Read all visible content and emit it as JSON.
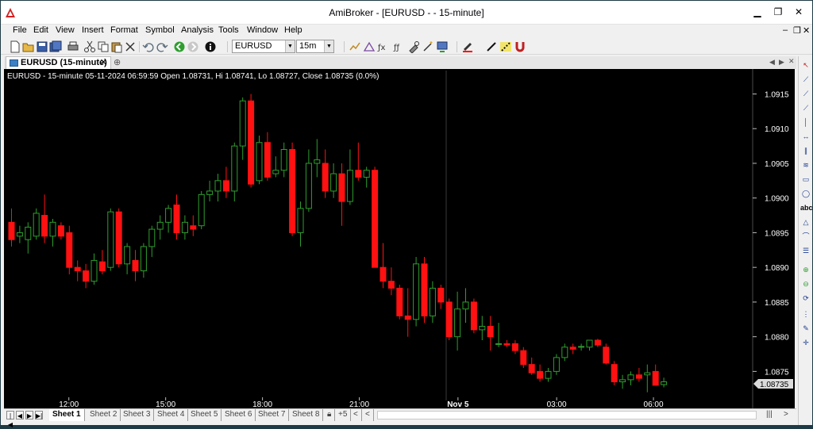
{
  "window": {
    "title": "AmiBroker - [EURUSD -  - 15-minute]",
    "min_label": "▁",
    "max_label": "❐",
    "close_label": "✕"
  },
  "menu": {
    "items": [
      "File",
      "Edit",
      "View",
      "Insert",
      "Format",
      "Symbol",
      "Analysis",
      "Tools",
      "Window",
      "Help"
    ]
  },
  "toolbar": {
    "symbol": "EURUSD",
    "interval": "15m"
  },
  "tab": {
    "label": "EURUSD (15-minute)",
    "close": "✕"
  },
  "chart": {
    "info_line": "EURUSD - 15-minute 05-11-2024 06:59:59 Open 1.08731, Hi 1.08741, Lo 1.08727, Close 1.08735 (0.0%)",
    "last_price": "1.08735",
    "y_ticks": [
      "1.0915",
      "1.0910",
      "1.0905",
      "1.0900",
      "1.0895",
      "1.0890",
      "1.0885",
      "1.0880",
      "1.0875"
    ],
    "x_ticks": [
      "12:00",
      "15:00",
      "18:00",
      "21:00",
      "Nov 5",
      "03:00",
      "06:00"
    ],
    "colors": {
      "up": "#2e9e2e",
      "down": "#ff1111",
      "background": "#000000",
      "axis_text": "#ffffff"
    }
  },
  "chart_data": {
    "type": "candlestick",
    "symbol": "EURUSD",
    "interval": "15-minute",
    "ylim": [
      1.08715,
      1.0917
    ],
    "candles": [
      {
        "o": 1.08965,
        "h": 1.08985,
        "l": 1.0893,
        "c": 1.0894
      },
      {
        "o": 1.08945,
        "h": 1.0896,
        "l": 1.08935,
        "c": 1.0895
      },
      {
        "o": 1.0894,
        "h": 1.08965,
        "l": 1.0892,
        "c": 1.08958
      },
      {
        "o": 1.08945,
        "h": 1.08985,
        "l": 1.0894,
        "c": 1.08978
      },
      {
        "o": 1.08975,
        "h": 1.09005,
        "l": 1.08935,
        "c": 1.08945
      },
      {
        "o": 1.08945,
        "h": 1.0897,
        "l": 1.0893,
        "c": 1.08965
      },
      {
        "o": 1.0896,
        "h": 1.08965,
        "l": 1.0894,
        "c": 1.08945
      },
      {
        "o": 1.0895,
        "h": 1.0896,
        "l": 1.0889,
        "c": 1.089
      },
      {
        "o": 1.089,
        "h": 1.0891,
        "l": 1.0888,
        "c": 1.08895
      },
      {
        "o": 1.08895,
        "h": 1.08905,
        "l": 1.0887,
        "c": 1.0888
      },
      {
        "o": 1.0888,
        "h": 1.0892,
        "l": 1.08875,
        "c": 1.0891
      },
      {
        "o": 1.08908,
        "h": 1.08925,
        "l": 1.0889,
        "c": 1.08895
      },
      {
        "o": 1.089,
        "h": 1.08985,
        "l": 1.08895,
        "c": 1.0898
      },
      {
        "o": 1.0898,
        "h": 1.08985,
        "l": 1.089,
        "c": 1.08905
      },
      {
        "o": 1.08905,
        "h": 1.08935,
        "l": 1.0889,
        "c": 1.0893
      },
      {
        "o": 1.0891,
        "h": 1.08925,
        "l": 1.0888,
        "c": 1.08895
      },
      {
        "o": 1.08895,
        "h": 1.08935,
        "l": 1.08885,
        "c": 1.0893
      },
      {
        "o": 1.0893,
        "h": 1.0896,
        "l": 1.08915,
        "c": 1.08955
      },
      {
        "o": 1.08955,
        "h": 1.08975,
        "l": 1.0894,
        "c": 1.08965
      },
      {
        "o": 1.08965,
        "h": 1.0899,
        "l": 1.0895,
        "c": 1.08985
      },
      {
        "o": 1.0899,
        "h": 1.09005,
        "l": 1.0894,
        "c": 1.0895
      },
      {
        "o": 1.0895,
        "h": 1.08975,
        "l": 1.0894,
        "c": 1.08965
      },
      {
        "o": 1.0896,
        "h": 1.08975,
        "l": 1.08945,
        "c": 1.08955
      },
      {
        "o": 1.0896,
        "h": 1.0901,
        "l": 1.08955,
        "c": 1.09005
      },
      {
        "o": 1.09005,
        "h": 1.09025,
        "l": 1.08995,
        "c": 1.0901
      },
      {
        "o": 1.0901,
        "h": 1.09035,
        "l": 1.08995,
        "c": 1.09025
      },
      {
        "o": 1.09025,
        "h": 1.09045,
        "l": 1.09,
        "c": 1.0901
      },
      {
        "o": 1.0901,
        "h": 1.0908,
        "l": 1.08995,
        "c": 1.09075
      },
      {
        "o": 1.09075,
        "h": 1.09145,
        "l": 1.09055,
        "c": 1.0914
      },
      {
        "o": 1.0914,
        "h": 1.0915,
        "l": 1.09015,
        "c": 1.0902
      },
      {
        "o": 1.09025,
        "h": 1.0909,
        "l": 1.0902,
        "c": 1.0908
      },
      {
        "o": 1.0908,
        "h": 1.09095,
        "l": 1.09025,
        "c": 1.0903
      },
      {
        "o": 1.09035,
        "h": 1.0906,
        "l": 1.0903,
        "c": 1.0904
      },
      {
        "o": 1.0904,
        "h": 1.0908,
        "l": 1.0903,
        "c": 1.0907
      },
      {
        "o": 1.0907,
        "h": 1.0908,
        "l": 1.08945,
        "c": 1.0895
      },
      {
        "o": 1.0895,
        "h": 1.08995,
        "l": 1.0893,
        "c": 1.08985
      },
      {
        "o": 1.08985,
        "h": 1.0907,
        "l": 1.0898,
        "c": 1.0905
      },
      {
        "o": 1.0905,
        "h": 1.09085,
        "l": 1.0903,
        "c": 1.09055
      },
      {
        "o": 1.0905,
        "h": 1.0907,
        "l": 1.09,
        "c": 1.0901
      },
      {
        "o": 1.0901,
        "h": 1.0905,
        "l": 1.09,
        "c": 1.09035
      },
      {
        "o": 1.09035,
        "h": 1.0905,
        "l": 1.0896,
        "c": 1.08995
      },
      {
        "o": 1.08995,
        "h": 1.0907,
        "l": 1.0899,
        "c": 1.0904
      },
      {
        "o": 1.0904,
        "h": 1.0908,
        "l": 1.09025,
        "c": 1.0903
      },
      {
        "o": 1.0903,
        "h": 1.09045,
        "l": 1.09015,
        "c": 1.0904
      },
      {
        "o": 1.0904,
        "h": 1.09045,
        "l": 1.089,
        "c": 1.089
      },
      {
        "o": 1.089,
        "h": 1.08935,
        "l": 1.0887,
        "c": 1.0888
      },
      {
        "o": 1.0888,
        "h": 1.089,
        "l": 1.0886,
        "c": 1.0887
      },
      {
        "o": 1.0887,
        "h": 1.08875,
        "l": 1.08825,
        "c": 1.0883
      },
      {
        "o": 1.0883,
        "h": 1.0887,
        "l": 1.088,
        "c": 1.08825
      },
      {
        "o": 1.08825,
        "h": 1.08915,
        "l": 1.08815,
        "c": 1.08905
      },
      {
        "o": 1.08905,
        "h": 1.08915,
        "l": 1.0882,
        "c": 1.0883
      },
      {
        "o": 1.0883,
        "h": 1.0888,
        "l": 1.0882,
        "c": 1.0887
      },
      {
        "o": 1.0887,
        "h": 1.08875,
        "l": 1.0884,
        "c": 1.0885
      },
      {
        "o": 1.0885,
        "h": 1.08855,
        "l": 1.08795,
        "c": 1.088
      },
      {
        "o": 1.088,
        "h": 1.08865,
        "l": 1.0878,
        "c": 1.0884
      },
      {
        "o": 1.0884,
        "h": 1.0887,
        "l": 1.0882,
        "c": 1.0885
      },
      {
        "o": 1.0885,
        "h": 1.08855,
        "l": 1.08805,
        "c": 1.0881
      },
      {
        "o": 1.0881,
        "h": 1.0883,
        "l": 1.08795,
        "c": 1.08815
      },
      {
        "o": 1.08815,
        "h": 1.0883,
        "l": 1.0878,
        "c": 1.088
      },
      {
        "o": 1.0879,
        "h": 1.0882,
        "l": 1.08785,
        "c": 1.0879
      },
      {
        "o": 1.0879,
        "h": 1.08795,
        "l": 1.08785,
        "c": 1.08788
      },
      {
        "o": 1.0879,
        "h": 1.08795,
        "l": 1.08775,
        "c": 1.0878
      },
      {
        "o": 1.0878,
        "h": 1.08785,
        "l": 1.08755,
        "c": 1.0876
      },
      {
        "o": 1.0876,
        "h": 1.0877,
        "l": 1.08745,
        "c": 1.08748
      },
      {
        "o": 1.0875,
        "h": 1.0876,
        "l": 1.08735,
        "c": 1.0874
      },
      {
        "o": 1.0874,
        "h": 1.08755,
        "l": 1.08735,
        "c": 1.0875
      },
      {
        "o": 1.0875,
        "h": 1.08775,
        "l": 1.08745,
        "c": 1.0877
      },
      {
        "o": 1.0877,
        "h": 1.0879,
        "l": 1.08765,
        "c": 1.08785
      },
      {
        "o": 1.08785,
        "h": 1.0879,
        "l": 1.08775,
        "c": 1.08782
      },
      {
        "o": 1.08785,
        "h": 1.0879,
        "l": 1.0878,
        "c": 1.08786
      },
      {
        "o": 1.08785,
        "h": 1.08795,
        "l": 1.0878,
        "c": 1.08795
      },
      {
        "o": 1.08795,
        "h": 1.08797,
        "l": 1.08785,
        "c": 1.08788
      },
      {
        "o": 1.08785,
        "h": 1.0879,
        "l": 1.0876,
        "c": 1.08762
      },
      {
        "o": 1.0876,
        "h": 1.08765,
        "l": 1.0873,
        "c": 1.08735
      },
      {
        "o": 1.08735,
        "h": 1.08745,
        "l": 1.08725,
        "c": 1.08738
      },
      {
        "o": 1.08738,
        "h": 1.0875,
        "l": 1.0873,
        "c": 1.08745
      },
      {
        "o": 1.08745,
        "h": 1.08755,
        "l": 1.08735,
        "c": 1.0874
      },
      {
        "o": 1.08745,
        "h": 1.0876,
        "l": 1.0872,
        "c": 1.08748
      },
      {
        "o": 1.0875,
        "h": 1.0876,
        "l": 1.0873,
        "c": 1.0873
      },
      {
        "o": 1.08731,
        "h": 1.08741,
        "l": 1.08727,
        "c": 1.08735
      }
    ]
  },
  "sheets": {
    "items": [
      "Sheet 1",
      "Sheet 2",
      "Sheet 3",
      "Sheet 4",
      "Sheet 5",
      "Sheet 6",
      "Sheet 7",
      "Sheet 8"
    ],
    "counter": "+5"
  },
  "icons": {
    "toolbar": [
      "new-icon",
      "open-icon",
      "save-icon",
      "save-all-icon",
      "print-icon",
      "cut-icon",
      "copy-icon",
      "paste-icon",
      "delete-icon",
      "undo-icon",
      "redo-icon",
      "back-icon",
      "forward-icon",
      "info-icon"
    ],
    "drawing": [
      "select-icon",
      "line-icon",
      "ray-icon",
      "extended-line-icon",
      "vertical-line-icon",
      "horizontal-line-icon",
      "parallel-lines-icon",
      "channel-icon",
      "rectangle-icon",
      "ellipse-icon",
      "text-icon",
      "triangle-icon",
      "arc-icon",
      "fibonacci-icon",
      "more-icon"
    ]
  }
}
